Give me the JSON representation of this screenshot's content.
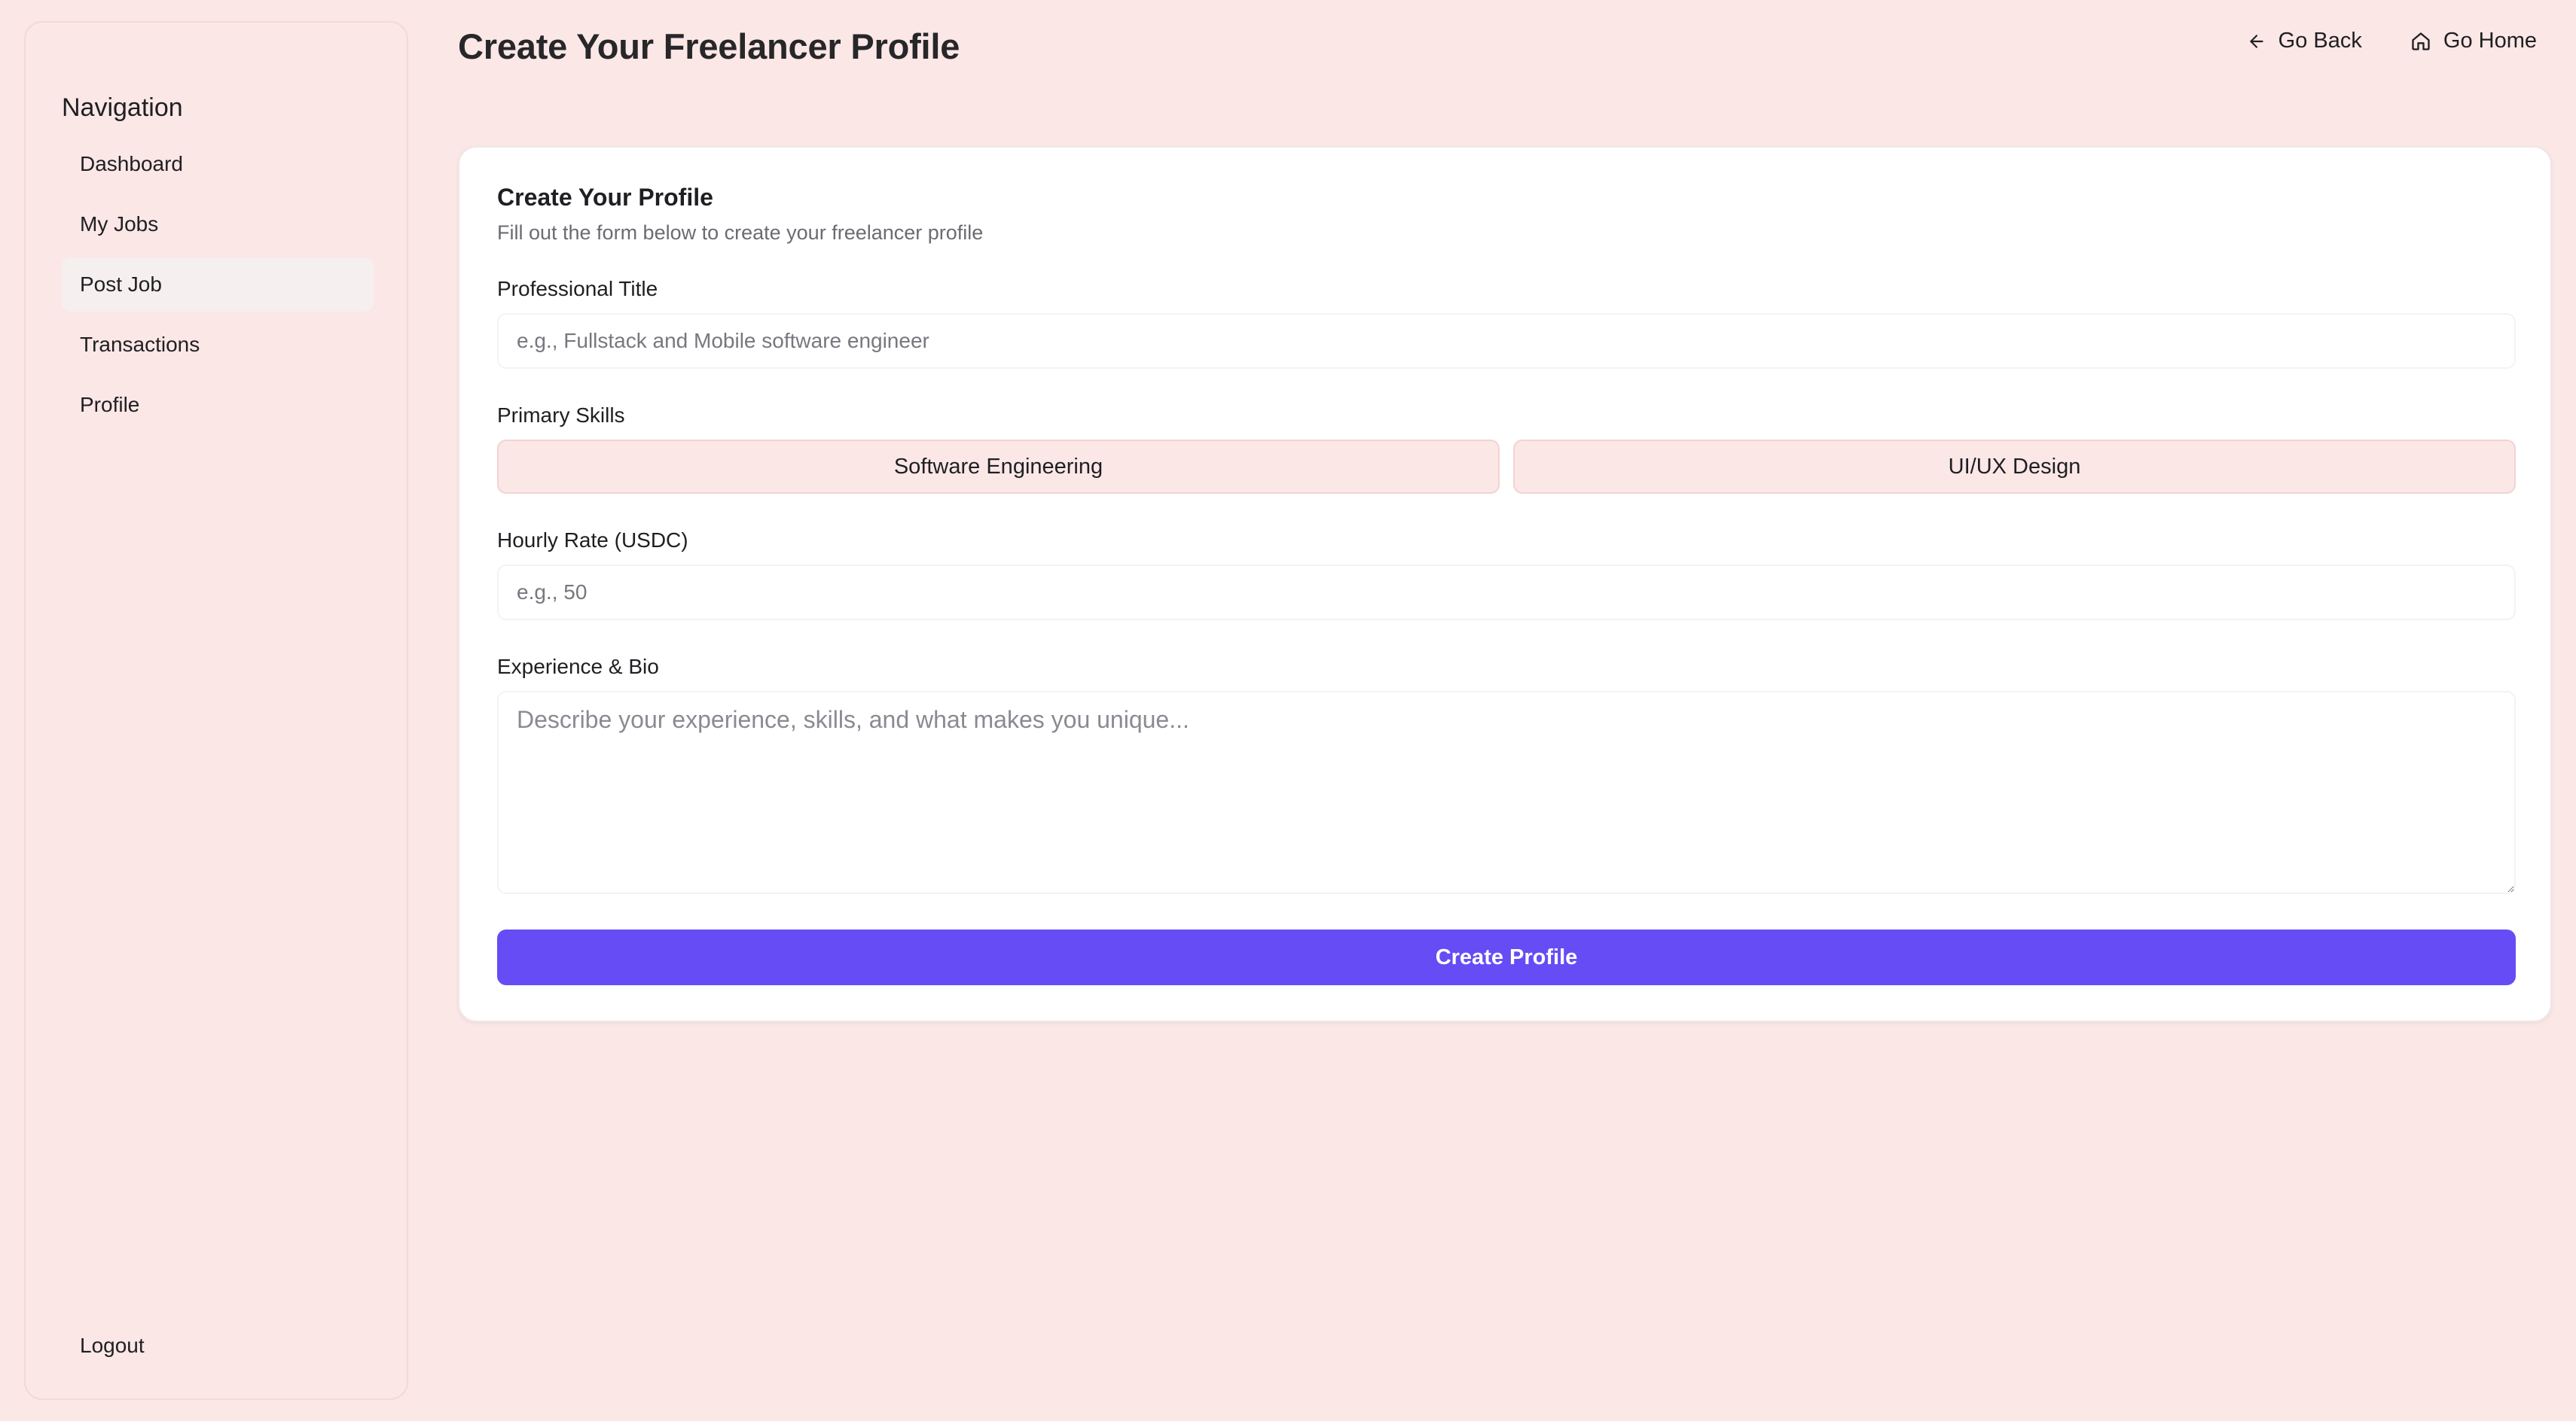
{
  "sidebar": {
    "heading": "Navigation",
    "items": [
      {
        "label": "Dashboard",
        "active": false
      },
      {
        "label": "My Jobs",
        "active": false
      },
      {
        "label": "Post Job",
        "active": true
      },
      {
        "label": "Transactions",
        "active": false
      },
      {
        "label": "Profile",
        "active": false
      }
    ],
    "logout_label": "Logout"
  },
  "header": {
    "title": "Create Your Freelancer Profile",
    "back_label": "Go Back",
    "back_icon": "arrow-left-icon",
    "home_label": "Go Home",
    "home_icon": "home-icon"
  },
  "form": {
    "title": "Create Your Profile",
    "subtitle": "Fill out the form below to create your freelancer profile",
    "professional_title": {
      "label": "Professional Title",
      "value": "",
      "placeholder": "e.g., Fullstack and Mobile software engineer"
    },
    "primary_skills": {
      "label": "Primary Skills",
      "options": [
        "Software Engineering",
        "UI/UX Design"
      ]
    },
    "hourly_rate": {
      "label": "Hourly Rate (USDC)",
      "value": "",
      "placeholder": "e.g., 50"
    },
    "bio": {
      "label": "Experience & Bio",
      "value": "",
      "placeholder": "Describe your experience, skills, and what makes you unique..."
    },
    "submit_label": "Create Profile"
  },
  "colors": {
    "background": "#fbe7e6",
    "accent": "#664cf5",
    "card": "#ffffff",
    "skill_button": "#fbe7e6"
  }
}
